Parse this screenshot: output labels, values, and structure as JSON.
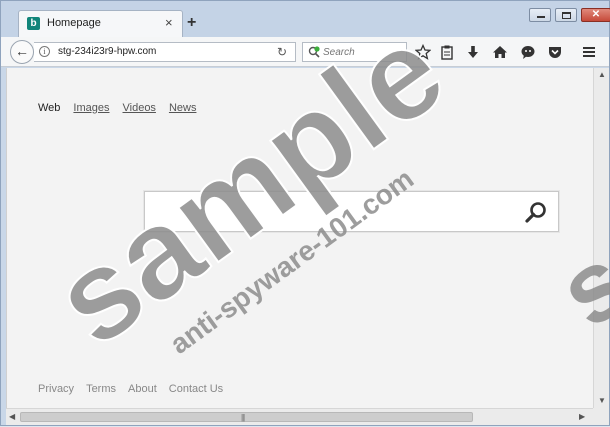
{
  "tab": {
    "title": "Homepage",
    "favicon": "bing-icon",
    "favicon_letter": "b",
    "close": "×"
  },
  "new_tab": "+",
  "window_controls": [
    "minimize-icon",
    "maximize-icon",
    "close-icon"
  ],
  "address_bar": {
    "url": "stg-234i23r9-hpw.com",
    "info": "i",
    "reload": "↻"
  },
  "search_bar": {
    "placeholder": "Search"
  },
  "toolbar_icons": [
    "star-icon",
    "clipboard-icon",
    "download-icon",
    "home-icon",
    "chat-icon",
    "pocket-icon",
    "menu-icon"
  ],
  "page": {
    "scopes": {
      "web": "Web",
      "images": "Images",
      "videos": "Videos",
      "news": "News"
    },
    "search_input": {
      "value": ""
    },
    "footer": {
      "privacy": "Privacy",
      "terms": "Terms",
      "about": "About",
      "contact": "Contact Us"
    }
  },
  "watermark": {
    "word": "sample",
    "site": "anti-spyware-101.com"
  },
  "colors": {
    "tab_strip": "#c4d3e6",
    "favicon": "#11857a",
    "watermark": "#8c8c8c"
  }
}
